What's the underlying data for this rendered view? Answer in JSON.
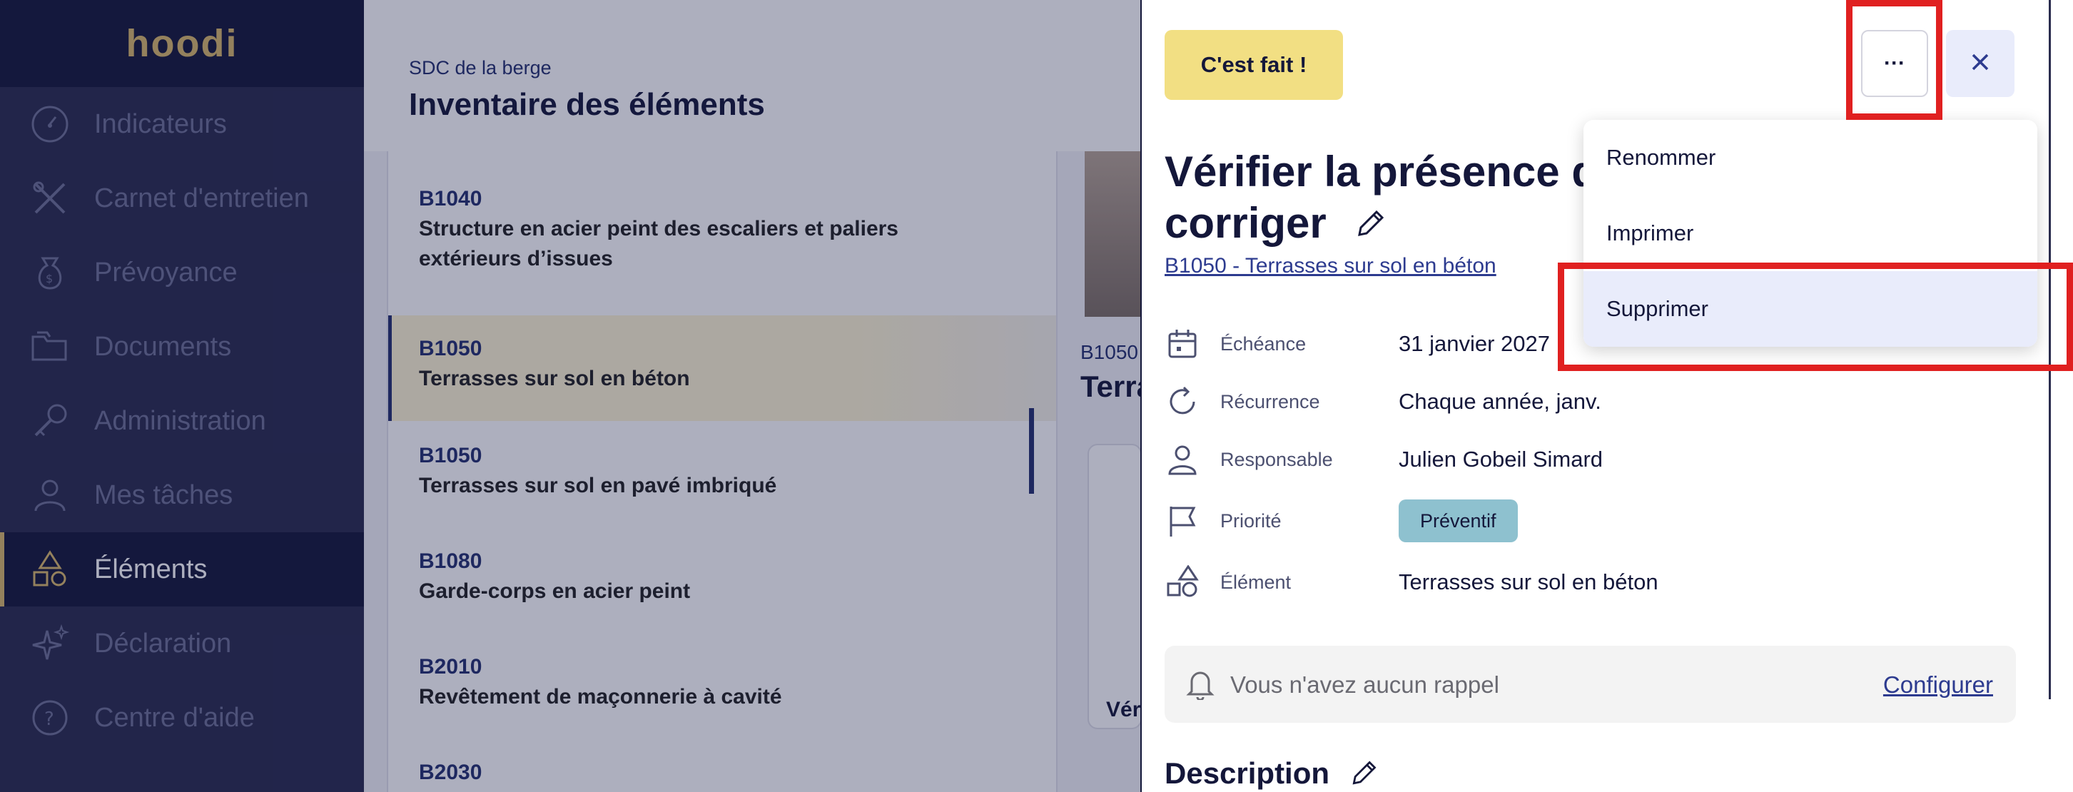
{
  "brand": {
    "logo": "hoodi",
    "color": "#d9b96a"
  },
  "sidebar": {
    "items": [
      {
        "label": "Indicateurs",
        "icon": "gauge-icon"
      },
      {
        "label": "Carnet d'entretien",
        "icon": "tools-icon"
      },
      {
        "label": "Prévoyance",
        "icon": "money-bag-icon"
      },
      {
        "label": "Documents",
        "icon": "folders-icon"
      },
      {
        "label": "Administration",
        "icon": "key-icon"
      },
      {
        "label": "Mes tâches",
        "icon": "user-icon"
      },
      {
        "label": "Éléments",
        "icon": "shapes-icon",
        "active": true
      },
      {
        "label": "Déclaration",
        "icon": "sparkle-icon"
      },
      {
        "label": "Centre d'aide",
        "icon": "help-icon"
      }
    ]
  },
  "main": {
    "breadcrumb": "SDC de la berge",
    "title": "Inventaire des éléments",
    "list": [
      {
        "code": "B1040",
        "label": "Structure en acier peint des escaliers et paliers extérieurs d’issues"
      },
      {
        "code": "B1050",
        "label": "Terrasses sur sol en béton",
        "selected": true
      },
      {
        "code": "B1050",
        "label": "Terrasses sur sol en pavé imbriqué"
      },
      {
        "code": "B1080",
        "label": "Garde-corps en acier peint"
      },
      {
        "code": "B2010",
        "label": "Revêtement de maçonnerie à cavité"
      },
      {
        "code": "B2030",
        "label": ""
      }
    ],
    "side_code": "B1050",
    "side_title": "Terra",
    "side_ver": "Vér"
  },
  "drawer": {
    "done_label": "C'est fait !",
    "more_label": "···",
    "title_line1": "Vérifier la présence de",
    "title_line2": "corriger",
    "element_link": "B1050 - Terrasses sur sol en béton",
    "fields": {
      "due": {
        "label": "Échéance",
        "value": "31 janvier 2027"
      },
      "recurrence": {
        "label": "Récurrence",
        "value": "Chaque année, janv."
      },
      "owner": {
        "label": "Responsable",
        "value": "Julien Gobeil Simard"
      },
      "priority": {
        "label": "Priorité",
        "value": "Préventif"
      },
      "element": {
        "label": "Élément",
        "value": "Terrasses sur sol en béton"
      }
    },
    "reminder_text": "Vous n'avez aucun rappel",
    "reminder_link": "Configurer",
    "description_title": "Description"
  },
  "menu": {
    "items": [
      "Renommer",
      "Imprimer",
      "Supprimer"
    ],
    "highlighted": "Supprimer"
  },
  "colors": {
    "sidebar_bg": "#2a2c4e",
    "accent_yellow": "#f2df83",
    "badge_teal": "#8ec1cf",
    "annotation_red": "#e02020"
  }
}
